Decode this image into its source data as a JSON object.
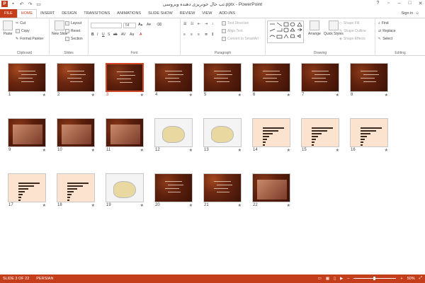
{
  "app": {
    "title": "تب خال خونریزی دهنده ویروسی.pptx - PowerPoint",
    "sign_in": "Sign in"
  },
  "tabs": [
    "FILE",
    "HOME",
    "INSERT",
    "DESIGN",
    "TRANSITIONS",
    "ANIMATIONS",
    "SLIDE SHOW",
    "REVIEW",
    "VIEW",
    "ADD-INS"
  ],
  "ribbon": {
    "clipboard": {
      "label": "Clipboard",
      "paste": "Paste",
      "cut": "Cut",
      "copy": "Copy",
      "format_painter": "Format Painter"
    },
    "slides": {
      "label": "Slides",
      "new_slide": "New Slide",
      "layout": "Layout",
      "reset": "Reset",
      "section": "Section"
    },
    "font": {
      "label": "Font",
      "size": "54"
    },
    "paragraph": {
      "label": "Paragraph",
      "text_direction": "Text Direction",
      "align_text": "Align Text",
      "convert_smartart": "Convert to SmartArt"
    },
    "drawing": {
      "label": "Drawing",
      "arrange": "Arrange",
      "quick_styles": "Quick Styles",
      "shape_fill": "Shape Fill",
      "shape_outline": "Shape Outline",
      "shape_effects": "Shape Effects"
    },
    "editing": {
      "label": "Editing",
      "find": "Find",
      "replace": "Replace",
      "select": "Select"
    }
  },
  "slides": [
    {
      "num": "1",
      "theme": "virus"
    },
    {
      "num": "2",
      "theme": "virus"
    },
    {
      "num": "3",
      "theme": "dark",
      "selected": true
    },
    {
      "num": "4",
      "theme": "dark"
    },
    {
      "num": "5",
      "theme": "dark"
    },
    {
      "num": "6",
      "theme": "dark"
    },
    {
      "num": "7",
      "theme": "dark"
    },
    {
      "num": "8",
      "theme": "dark"
    },
    {
      "num": "9",
      "theme": "photo"
    },
    {
      "num": "10",
      "theme": "photo"
    },
    {
      "num": "11",
      "theme": "photo"
    },
    {
      "num": "12",
      "theme": "map"
    },
    {
      "num": "13",
      "theme": "map"
    },
    {
      "num": "14",
      "theme": "chart"
    },
    {
      "num": "15",
      "theme": "chart"
    },
    {
      "num": "16",
      "theme": "chart"
    },
    {
      "num": "17",
      "theme": "chart"
    },
    {
      "num": "18",
      "theme": "chart"
    },
    {
      "num": "19",
      "theme": "map"
    },
    {
      "num": "20",
      "theme": "dark"
    },
    {
      "num": "21",
      "theme": "virus"
    },
    {
      "num": "22",
      "theme": "photo"
    }
  ],
  "star_glyph": "★",
  "status": {
    "slide_info": "SLIDE 3 OF 22",
    "language": "PERSIAN",
    "zoom": "50%"
  },
  "colors": {
    "accent": "#c43e1c",
    "selected": "#d24726"
  }
}
